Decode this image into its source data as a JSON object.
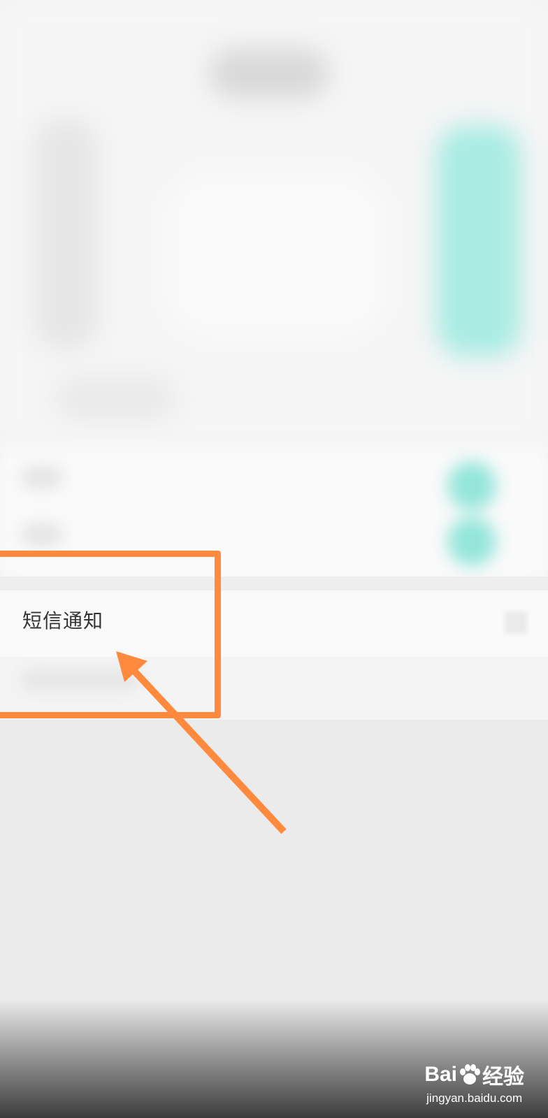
{
  "settings": {
    "sms_notification_label": "短信通知"
  },
  "annotation": {
    "highlight_color": "#ff8a3d",
    "accent_teal": "#94e6da"
  },
  "watermark": {
    "brand_left": "Bai",
    "brand_right": "经验",
    "url": "jingyan.baidu.com"
  }
}
